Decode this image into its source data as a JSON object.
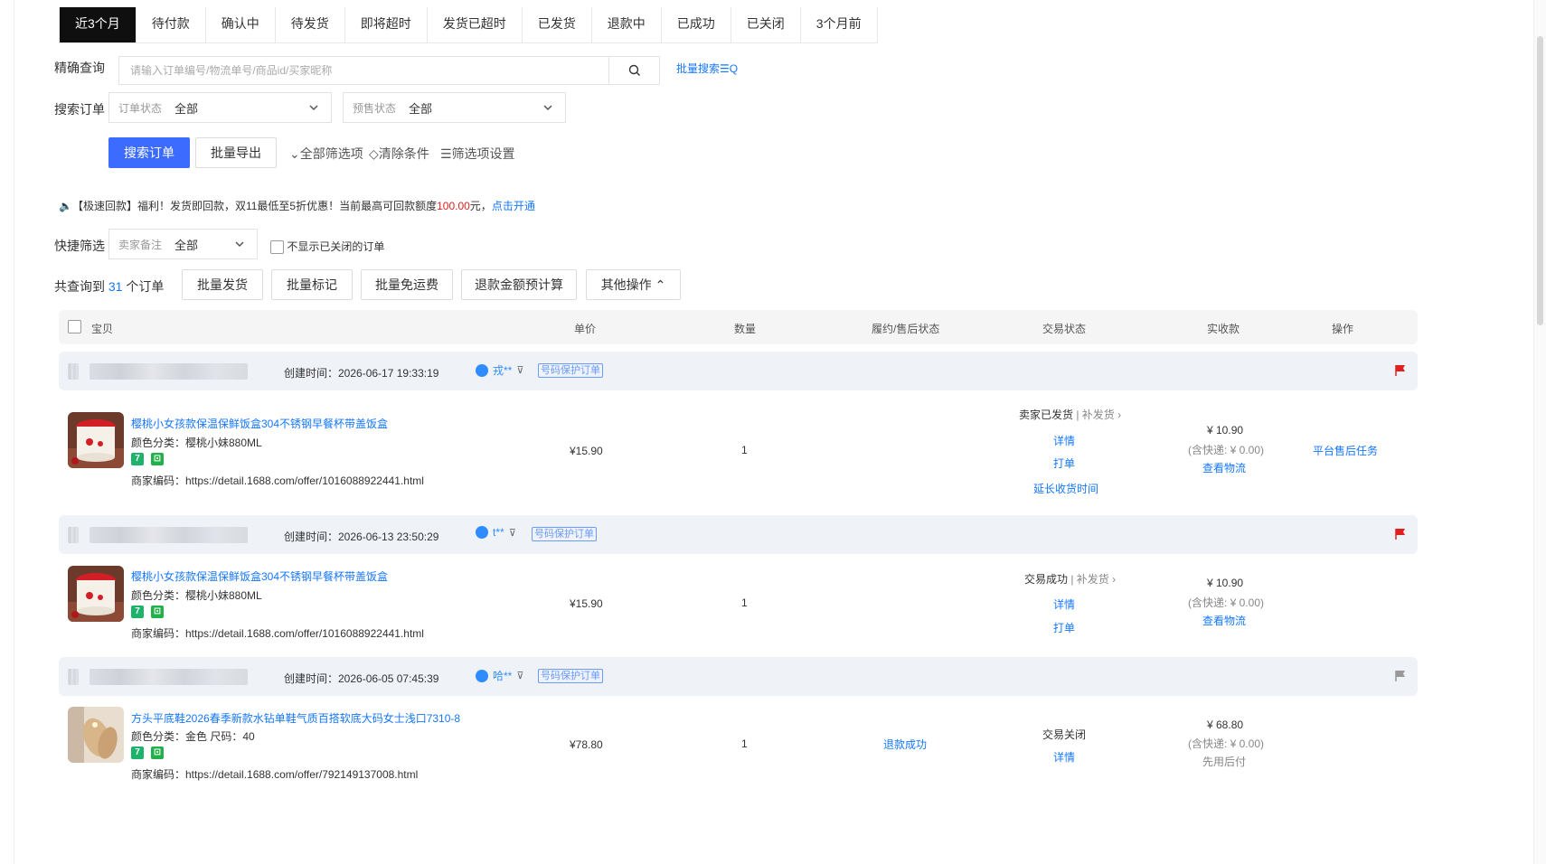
{
  "tabs": [
    "近3个月",
    "待付款",
    "确认中",
    "待发货",
    "即将超时",
    "发货已超时",
    "已发货",
    "退款中",
    "已成功",
    "已关闭",
    "3个月前"
  ],
  "search": {
    "label": "精确查询",
    "placeholder": "请输入订单编号/物流单号/商品id/买家昵称",
    "batch_link": "批量搜索☰Q"
  },
  "filters": {
    "label": "搜索订单",
    "order_status": {
      "label": "订单状态",
      "value": "全部"
    },
    "presale_status": {
      "label": "预售状态",
      "value": "全部"
    }
  },
  "actions": {
    "search_btn": "搜索订单",
    "export_btn": "批量导出",
    "all_filters": "全部筛选项",
    "clear": "清除条件",
    "settings": "筛选项设置"
  },
  "notice": {
    "prefix": "【极速回款】福利！发货即回款，双11最低至5折优惠！当前最高可回款额度",
    "amount": "100.00",
    "suffix": "元，",
    "link": "点击开通"
  },
  "quick": {
    "label": "快捷筛选",
    "remark": {
      "label": "卖家备注",
      "value": "全部"
    },
    "hide_closed": "不显示已关闭的订单"
  },
  "summary": {
    "prefix": "共查询到",
    "count": "31",
    "suffix": "个订单"
  },
  "bulk": [
    "批量发货",
    "批量标记",
    "批量免运费",
    "退款金额预计算",
    "其他操作 ⌃"
  ],
  "table_header": {
    "item": "宝贝",
    "price": "单价",
    "qty": "数量",
    "after_sale": "履约/售后状态",
    "trade_status": "交易状态",
    "received": "实收款",
    "ops": "操作"
  },
  "orders": [
    {
      "created": "创建时间：2026-06-17 19:33:19",
      "buyer": "戎**",
      "tag": "号码保护订单",
      "flag_color": "#e02020",
      "title": "樱桃小女孩款保温保鲜饭盒304不锈钢早餐杯带盖饭盒",
      "attr": "颜色分类：樱桃小妹880ML",
      "code": "商家编码：https://detail.1688.com/offer/1016088922441.html",
      "price": "¥15.90",
      "qty": "1",
      "after_sale": "",
      "status_main": "卖家已发货",
      "status_sub": " | 补发货 ›",
      "links": [
        "详情",
        "打单",
        "延长收货时间"
      ],
      "received": "¥ 10.90",
      "shipping": "(含快递: ¥ 0.00)",
      "received_link": "查看物流",
      "op": "平台售后任务"
    },
    {
      "created": "创建时间：2026-06-13 23:50:29",
      "buyer": "t**",
      "tag": "号码保护订单",
      "flag_color": "#e02020",
      "title": "樱桃小女孩款保温保鲜饭盒304不锈钢早餐杯带盖饭盒",
      "attr": "颜色分类：樱桃小妹880ML",
      "code": "商家编码：https://detail.1688.com/offer/1016088922441.html",
      "price": "¥15.90",
      "qty": "1",
      "after_sale": "",
      "status_main": "交易成功",
      "status_sub": " | 补发货 ›",
      "links": [
        "详情",
        "打单"
      ],
      "received": "¥ 10.90",
      "shipping": "(含快递: ¥ 0.00)",
      "received_link": "查看物流",
      "op": ""
    },
    {
      "created": "创建时间：2026-06-05 07:45:39",
      "buyer": "哈**",
      "tag": "号码保护订单",
      "flag_color": "#999999",
      "title": "方头平底鞋2026春季新款水钻单鞋气质百搭软底大码女士浅口7310-8",
      "attr": "颜色分类：金色  尺码：40",
      "code": "商家编码：https://detail.1688.com/offer/792149137008.html",
      "price": "¥78.80",
      "qty": "1",
      "after_sale": "退款成功",
      "status_main": "交易关闭",
      "status_sub": "",
      "links": [
        "详情"
      ],
      "received": "¥ 68.80",
      "shipping": "(含快递: ¥ 0.00)",
      "received_link": "先用后付",
      "op": ""
    }
  ]
}
